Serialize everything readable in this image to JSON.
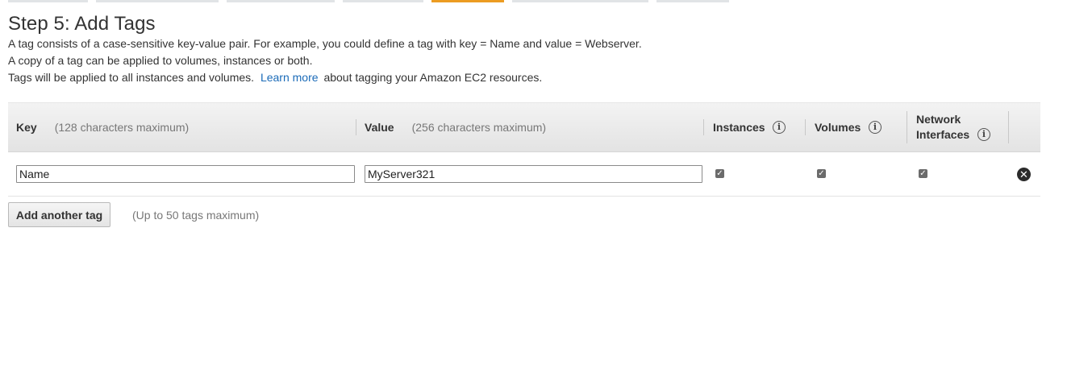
{
  "page": {
    "title": "Step 5: Add Tags",
    "description": {
      "line1": "A tag consists of a case-sensitive key-value pair. For example, you could define a tag with key = Name and value = Webserver.",
      "line2": "A copy of a tag can be applied to volumes, instances or both.",
      "line3_before": "Tags will be applied to all instances and volumes.",
      "line3_link": "Learn more",
      "line3_after": "about tagging your Amazon EC2 resources."
    }
  },
  "colors": {
    "active_step": "#ec9c22",
    "link": "#1b6bb8"
  },
  "table": {
    "headers": {
      "key_label": "Key",
      "key_hint": "(128 characters maximum)",
      "value_label": "Value",
      "value_hint": "(256 characters maximum)",
      "instances": "Instances",
      "volumes": "Volumes",
      "network_line1": "Network",
      "network_line2": "Interfaces"
    },
    "info_icon": "info-icon",
    "rows": [
      {
        "key": "Name",
        "value": "MyServer321",
        "instances": true,
        "volumes": true,
        "network_interfaces": true
      }
    ]
  },
  "footer": {
    "add_button": "Add another tag",
    "add_hint": "(Up to 50 tags maximum)"
  }
}
